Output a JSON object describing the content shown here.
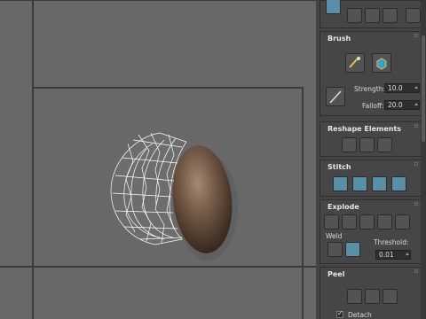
{
  "panel": {
    "brush": {
      "title": "Brush",
      "strength_label": "Strength:",
      "strength_value": "10.0",
      "falloff_label": "Falloff:",
      "falloff_value": "20.0"
    },
    "reshape": {
      "title": "Reshape Elements"
    },
    "stitch": {
      "title": "Stitch"
    },
    "explode": {
      "title": "Explode",
      "weld_label": "Weld",
      "threshold_label": "Threshold:",
      "threshold_value": "0.01"
    },
    "peel": {
      "title": "Peel",
      "detach_label": "Detach"
    }
  },
  "icons": {
    "brush_pin": "paint-brush-icon",
    "brush_relax": "relax-cube-icon",
    "brush_line": "line-tool-icon",
    "reshape": [
      "straighten-icon",
      "cube-front-icon",
      "cube-side-icon"
    ],
    "stitch": [
      "stitch-source-icon",
      "stitch-average-icon",
      "stitch-target-icon",
      "stitch-custom-icon"
    ],
    "explode": [
      "break-icon",
      "explode-icon",
      "explode-group-icon",
      "flatten-icon",
      "explode-faces-icon"
    ],
    "weld": [
      "weld-selected-icon",
      "weld-target-icon"
    ],
    "peel": [
      "quick-peel-icon",
      "peel-mode-icon",
      "peel-reset-icon"
    ]
  },
  "colors": {
    "viewport_bg": "#686868",
    "active_button": "#5a8fa8",
    "panel_bg": "#444444"
  }
}
